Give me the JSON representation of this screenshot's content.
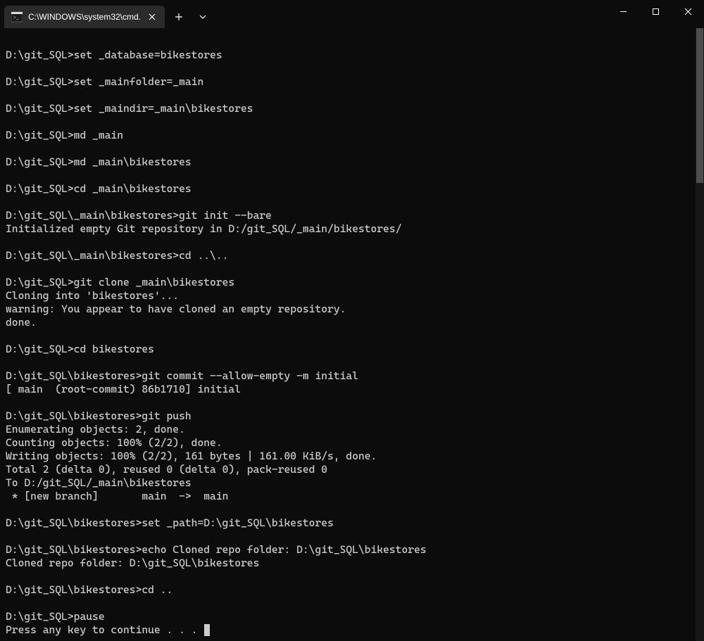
{
  "window": {
    "tab_title": "C:\\WINDOWS\\system32\\cmd."
  },
  "terminal": {
    "lines": [
      "",
      "D:\\git_SQL>set _database=bikestores",
      "",
      "D:\\git_SQL>set _mainfolder=_main",
      "",
      "D:\\git_SQL>set _maindir=_main\\bikestores",
      "",
      "D:\\git_SQL>md _main",
      "",
      "D:\\git_SQL>md _main\\bikestores",
      "",
      "D:\\git_SQL>cd _main\\bikestores",
      "",
      "D:\\git_SQL\\_main\\bikestores>git init --bare",
      "Initialized empty Git repository in D:/git_SQL/_main/bikestores/",
      "",
      "D:\\git_SQL\\_main\\bikestores>cd ..\\..",
      "",
      "D:\\git_SQL>git clone _main\\bikestores",
      "Cloning into 'bikestores'...",
      "warning: You appear to have cloned an empty repository.",
      "done.",
      "",
      "D:\\git_SQL>cd bikestores",
      "",
      "D:\\git_SQL\\bikestores>git commit --allow-empty -m initial",
      "[ main  (root-commit) 86b1710] initial",
      "",
      "D:\\git_SQL\\bikestores>git push",
      "Enumerating objects: 2, done.",
      "Counting objects: 100% (2/2), done.",
      "Writing objects: 100% (2/2), 161 bytes | 161.00 KiB/s, done.",
      "Total 2 (delta 0), reused 0 (delta 0), pack-reused 0",
      "To D:/git_SQL/_main\\bikestores",
      " * [new branch]       main  ->  main",
      "",
      "D:\\git_SQL\\bikestores>set _path=D:\\git_SQL\\bikestores",
      "",
      "D:\\git_SQL\\bikestores>echo Cloned repo folder: D:\\git_SQL\\bikestores",
      "Cloned repo folder: D:\\git_SQL\\bikestores",
      "",
      "D:\\git_SQL\\bikestores>cd ..",
      "",
      "D:\\git_SQL>pause",
      "Press any key to continue . . . "
    ]
  }
}
